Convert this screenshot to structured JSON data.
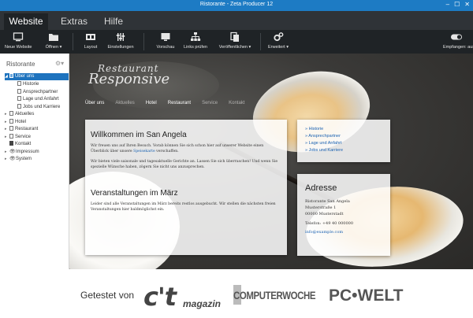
{
  "window": {
    "title": "Ristorante - Zeta Producer 12",
    "controls": [
      "–",
      "☐",
      "✕"
    ]
  },
  "menu_tabs": [
    {
      "label": "Website",
      "active": true
    },
    {
      "label": "Extras",
      "active": false
    },
    {
      "label": "Hilfe",
      "active": false
    }
  ],
  "ribbon": {
    "neue_website": "Neue Website",
    "oeffnen": "Öffnen ▾",
    "layout": "Layout",
    "einstellungen": "Einstellungen",
    "vorschau": "Vorschau",
    "links_pruefen": "Links prüfen",
    "veroeffentlichen": "Veröffentlichen ▾",
    "erweitert": "Erweitert ▾",
    "empfangen": "Empfangen: aus"
  },
  "sidebar": {
    "title": "Ristorante",
    "items": [
      {
        "label": "Über uns",
        "selected": true,
        "expanded": true
      },
      {
        "label": "Historie"
      },
      {
        "label": "Ansprechpartner"
      },
      {
        "label": "Lage und Anfahrt"
      },
      {
        "label": "Jobs und Karriere"
      },
      {
        "label": "Aktuelles"
      },
      {
        "label": "Hotel"
      },
      {
        "label": "Restaurant"
      },
      {
        "label": "Service"
      },
      {
        "label": "Kontakt"
      },
      {
        "label": "Impressum"
      },
      {
        "label": "System"
      }
    ]
  },
  "site": {
    "logo_top": "Restaurant",
    "logo_main": "Responsive",
    "nav": [
      "Über uns",
      "Aktuelles",
      "Hotel",
      "Restaurant",
      "Service",
      "Kontakt"
    ],
    "welcome": {
      "title": "Willkommen im San Angela",
      "p1_before": "Wir freuen uns auf Ihren Besuch. Vorab können Sie sich schon hier auf unserer Website einen Überblick über unsere ",
      "p1_link": "Speisekarte",
      "p1_after": " verschaffen.",
      "p2": "Wir bieten viele saisonale und tagesaktuelle Gerichte an. Lassen Sie sich überraschen! Und wenn Sie spezielle Wünsche haben, zögern Sie nicht uns anzusprechen."
    },
    "events": {
      "title": "Veranstaltungen im März",
      "text": "Leider sind alle Veranstaltungen im März bereits restlos ausgebucht. Wir stellen die nächsten freien Veranstaltungen hier baldmöglichst ein."
    },
    "subnav": [
      "» Historie",
      "» Ansprechpartner",
      "» Lage und Anfahrt",
      "» Jobs und Karriere"
    ],
    "address": {
      "title": "Adresse",
      "name": "Ristorante San Angela",
      "street": "Musterstraße 1",
      "city": "00000 Musterstadt",
      "phone": "Telefon: +49 40 000000",
      "email": "info@example.com"
    }
  },
  "banner": {
    "text": "Getestet von",
    "ct": "c't",
    "ct_magazin": "magazin",
    "computerwoche": "COMPUTERWOCHE",
    "pcwelt": "PC•WELT"
  }
}
